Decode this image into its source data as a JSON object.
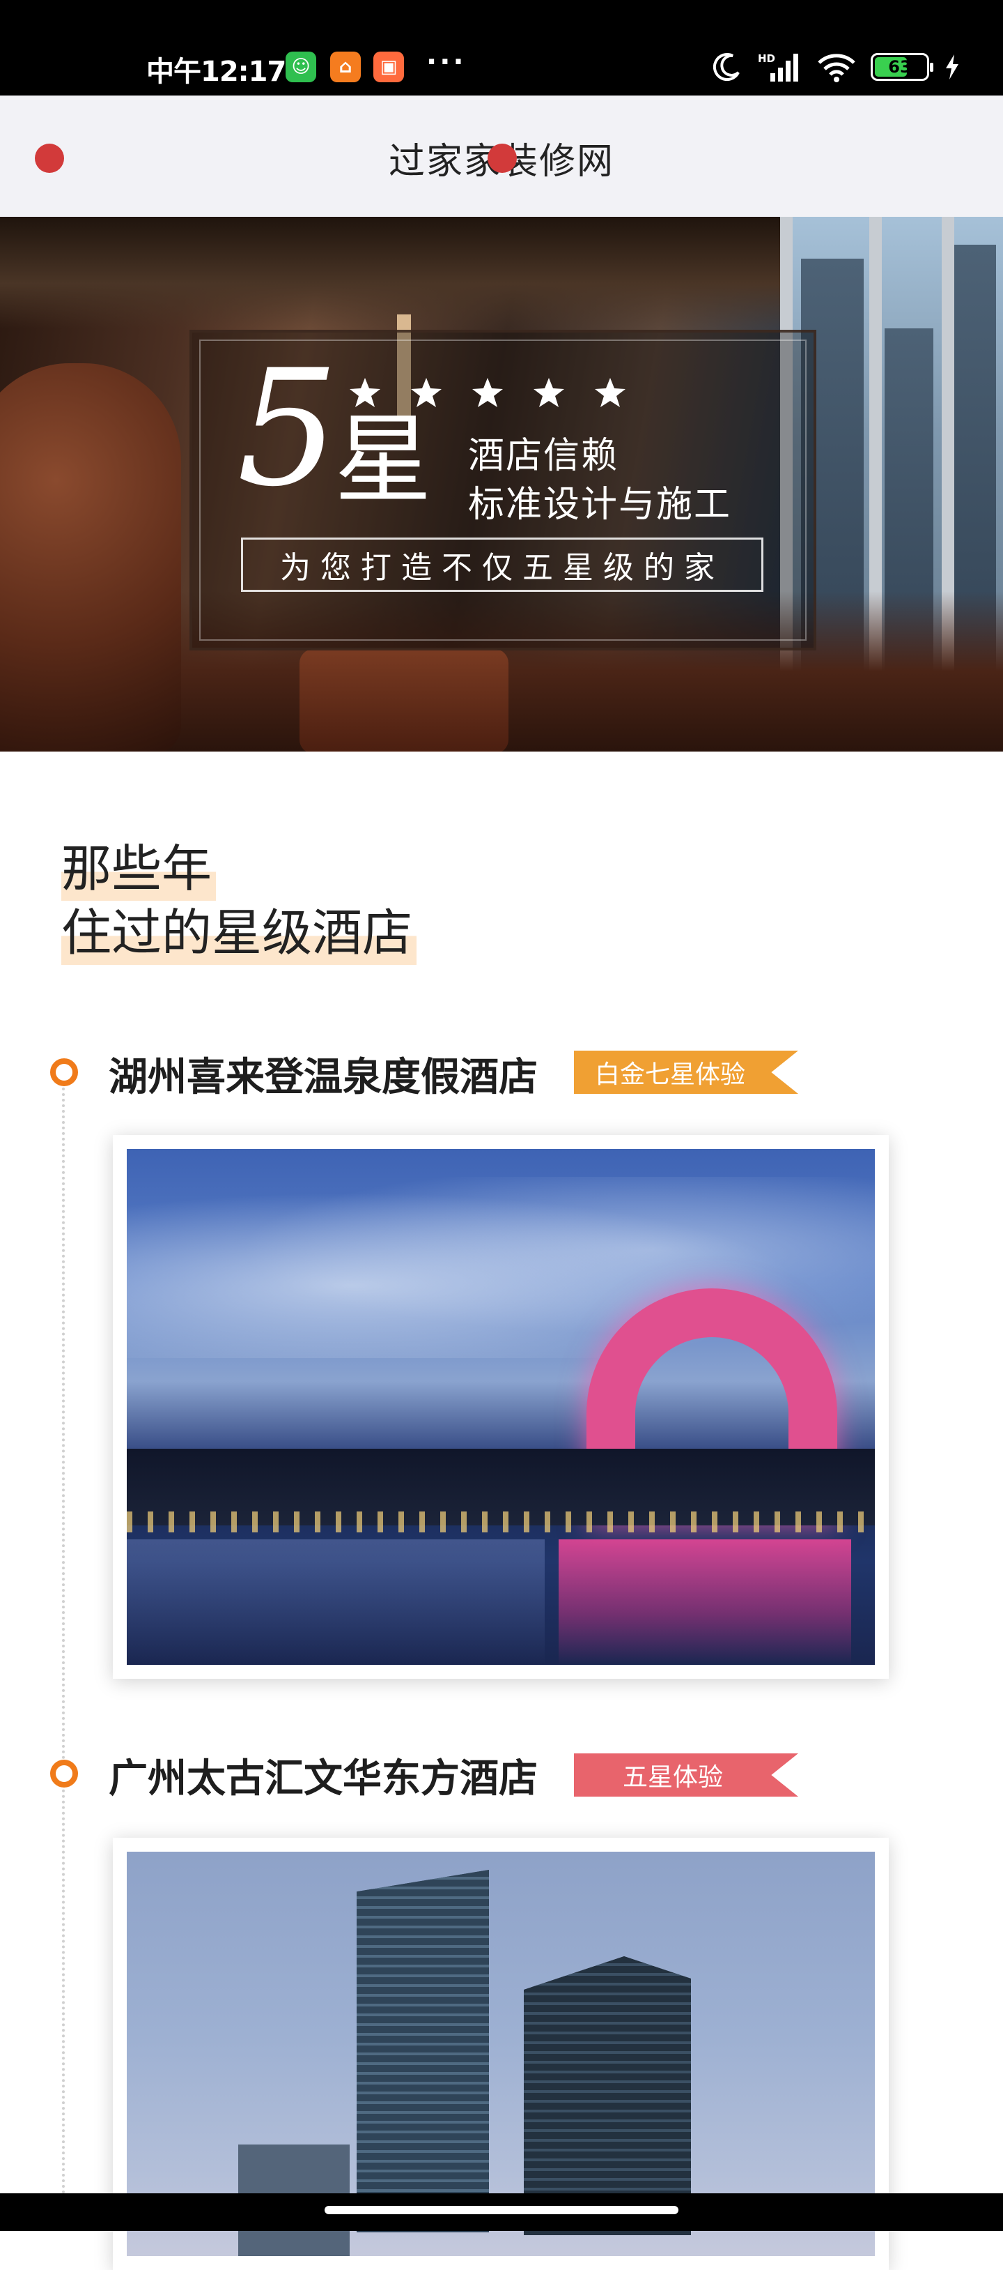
{
  "status_bar": {
    "time": "中午12:17",
    "more": "···",
    "network": "HD",
    "battery_level": "63",
    "app_icons": [
      "wechat-icon",
      "home-app-icon",
      "shopping-app-icon"
    ]
  },
  "header": {
    "title": "过家家装修网"
  },
  "hero": {
    "big_number": "5",
    "star_char": "星",
    "stars": 5,
    "tagline_1": "酒店信赖",
    "tagline_2": "标准设计与施工",
    "slogan": "为您打造不仅五星级的家"
  },
  "section": {
    "heading_line_1": "那些年",
    "heading_line_2": "住过的星级酒店"
  },
  "hotels": [
    {
      "name": "湖州喜来登温泉度假酒店",
      "badge": "白金七星体验",
      "badge_color": "#f0a033"
    },
    {
      "name": "广州太古汇文华东方酒店",
      "badge": "五星体验",
      "badge_color": "#e8646c"
    }
  ],
  "colors": {
    "accent": "#f07b1a",
    "header_bg": "#f2f2f6",
    "header_dot": "#d23a3a",
    "heading_highlight": "#fde6cc"
  }
}
